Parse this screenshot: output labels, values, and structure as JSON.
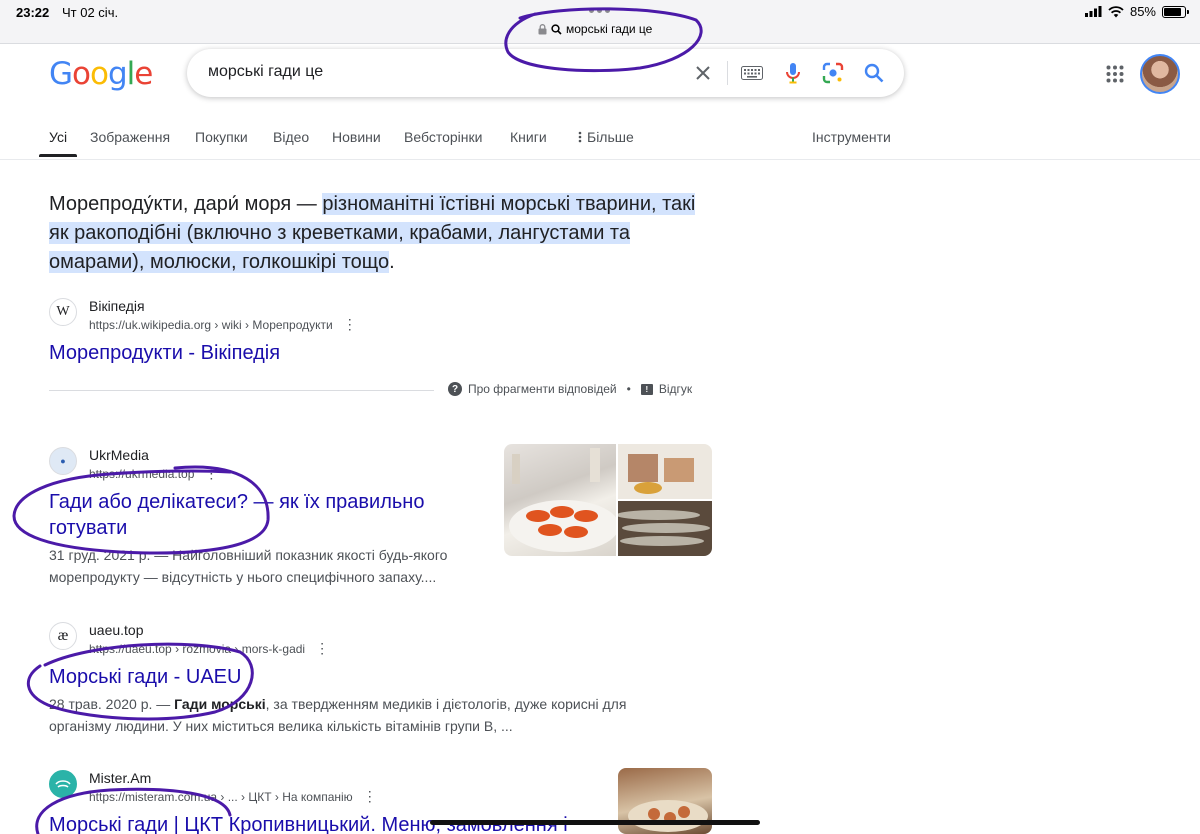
{
  "status_bar": {
    "time": "23:22",
    "date": "Чт 02 січ.",
    "url": "морські гади це",
    "battery": "85%",
    "battery_level": 0.85
  },
  "logo": "Google",
  "search": {
    "query": "морські гади це"
  },
  "tabs": [
    "Усі",
    "Зображення",
    "Покупки",
    "Відео",
    "Новини",
    "Вебсторінки",
    "Книги",
    "Більше"
  ],
  "tools": "Інструменти",
  "featured": {
    "text_before": "Морепроду́кти, дари́ моря — ",
    "text_highlight": "різноманітні їстівні морські тварини, такі як ракоподібні (включно з креветками, крабами, лангустами та омарами), молюски, голкошкірі тощо",
    "text_after": ".",
    "source_name": "Вікіпедія",
    "source_url": "https://uk.wikipedia.org › wiki › Морепродукти",
    "source_favicon": "W",
    "link_title": "Морепродукти - Вікіпедія",
    "about": "Про фрагменти відповідей",
    "feedback": "Відгук"
  },
  "results": [
    {
      "site": "UkrMedia",
      "url": "https://ukrmedia.top",
      "title_line1": "Гади або делікатеси? — як їх правильно",
      "title_line2": "готувати",
      "desc_line1": "31 груд. 2021 р. — Найголовніший показник якості будь-якого",
      "desc_line2": "морепродукту — відсутність у нього специфічного запаху...."
    },
    {
      "site": "uaeu.top",
      "url": "https://uaeu.top › rozmovia › mors-k-gadi",
      "favicon": "æ",
      "title": "Морські гади - UAEU",
      "date": "28 трав. 2020 р. — ",
      "bold": "Гади морські",
      "desc_rest": ", за твердженням медиків і дієтологів, дуже корисні для",
      "desc_line2": "організму людини. У них міститься велика кількість вітамінів групи В, ..."
    },
    {
      "site": "Mister.Am",
      "url": "https://misteram.com.ua › ... › ЦКТ › На компанію",
      "title": "Морські гади | ЦКТ Кропивницький. Меню, замовлення і"
    }
  ],
  "colors": {
    "link": "#1a0dab",
    "highlight": "#d3e3fd",
    "ink": "#4b1aa8"
  }
}
